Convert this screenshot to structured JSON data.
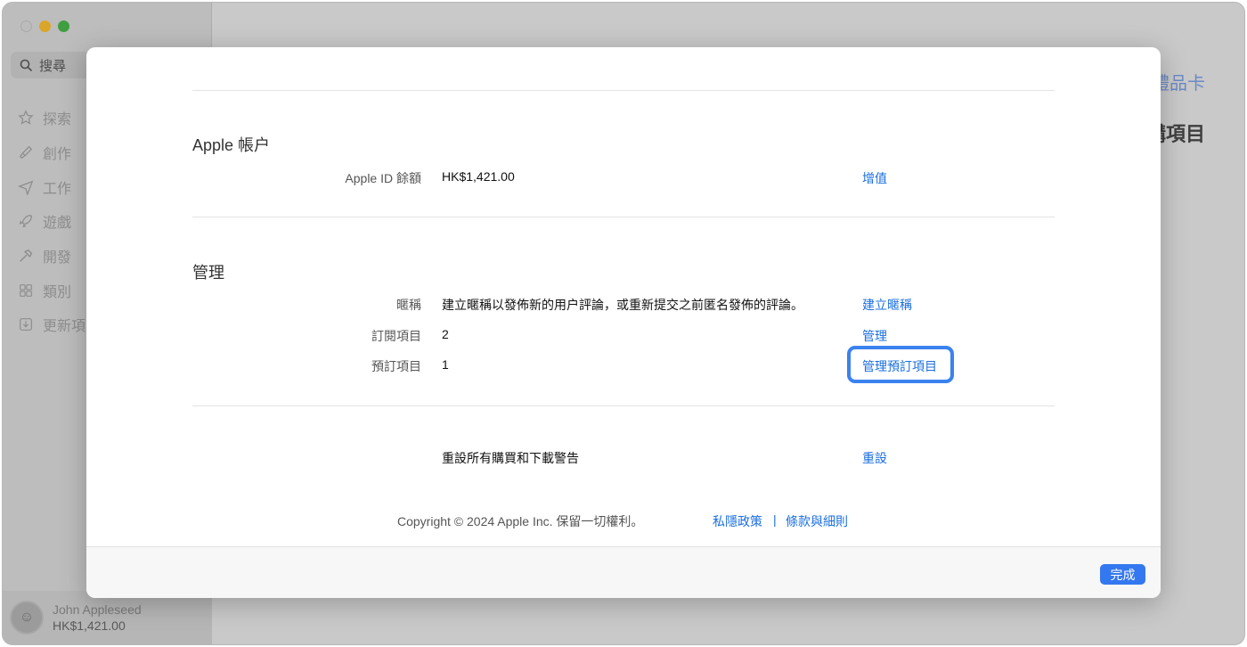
{
  "sidebar": {
    "search_placeholder": "搜尋",
    "items": [
      {
        "label": "探索",
        "icon": "star-icon"
      },
      {
        "label": "創作",
        "icon": "brush-icon"
      },
      {
        "label": "工作",
        "icon": "paper-plane-icon"
      },
      {
        "label": "遊戲",
        "icon": "rocket-icon"
      },
      {
        "label": "開發",
        "icon": "hammer-icon"
      },
      {
        "label": "類別",
        "icon": "grid-icon"
      },
      {
        "label": "更新項",
        "icon": "download-icon"
      }
    ],
    "user": {
      "name": "John Appleseed",
      "balance": "HK$1,421.00"
    }
  },
  "background": {
    "link_partial": "禮品卡",
    "heading_partial": "購項目"
  },
  "sheet": {
    "account": {
      "title": "Apple 帳户",
      "balance_label": "Apple ID 餘額",
      "balance_value": "HK$1,421.00",
      "balance_action": "增值"
    },
    "manage": {
      "title": "管理",
      "nickname_label": "暱稱",
      "nickname_value": "建立暱稱以發佈新的用户評論，或重新提交之前匿名發佈的評論。",
      "nickname_action": "建立暱稱",
      "subscriptions_label": "訂閱項目",
      "subscriptions_value": "2",
      "subscriptions_action": "管理",
      "preorders_label": "預訂項目",
      "preorders_value": "1",
      "preorders_action": "管理預訂項目"
    },
    "reset": {
      "text": "重設所有購買和下載警告",
      "action": "重設"
    },
    "footer": {
      "copyright": "Copyright © 2024 Apple Inc. 保留一切權利。",
      "privacy": "私隱政策",
      "separator": "|",
      "terms": "條款與細則"
    },
    "done_label": "完成"
  },
  "colors": {
    "accent": "#1b6fe0",
    "focus_ring": "#3a82f0",
    "done_button": "#3478f0"
  }
}
